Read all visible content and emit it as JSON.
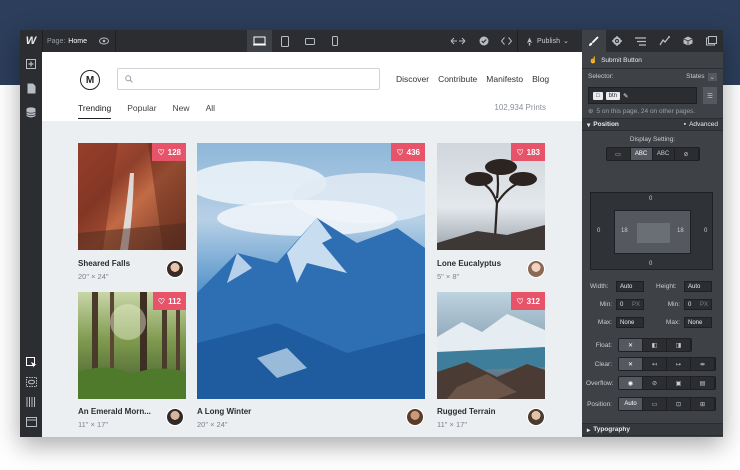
{
  "topbar": {
    "logo": "W",
    "page_label": "Page:",
    "page_value": "Home",
    "publish_label": "Publish"
  },
  "canvas": {
    "logo_letter": "M",
    "nav": [
      "Discover",
      "Contribute",
      "Manifesto",
      "Blog"
    ],
    "tabs": [
      "Trending",
      "Popular",
      "New",
      "All"
    ],
    "prints_count": "102,934 Prints",
    "cards": [
      {
        "title": "Sheared Falls",
        "size": "20\" × 24\"",
        "likes": "128"
      },
      {
        "title": "A Long Winter",
        "size": "20\" × 24\"",
        "likes": "436"
      },
      {
        "title": "Lone Eucalyptus",
        "size": "5\" × 8\"",
        "likes": "183"
      },
      {
        "title": "An Emerald Morn...",
        "size": "11\" × 17\"",
        "likes": "112"
      },
      {
        "title": "Rugged Terrain",
        "size": "11\" × 17\"",
        "likes": "312"
      }
    ]
  },
  "panel": {
    "element_label": "Submit Button",
    "selector_label": "Selector:",
    "states_label": "States",
    "chip_1": "□",
    "chip_2": "btn",
    "selector_note": "5 on this page, 24 on other pages.",
    "position_title": "Position",
    "advanced_label": "Advanced",
    "display_setting": "Display Setting:",
    "display_options": [
      "▭",
      "ABC",
      "ABC",
      "⊘"
    ],
    "box_values": {
      "outer_top": "0",
      "outer_left": "0",
      "outer_right": "0",
      "outer_bottom": "0",
      "pad_left": "18",
      "pad_right": "18"
    },
    "width_label": "Width:",
    "width_value": "Auto",
    "height_label": "Height:",
    "height_value": "Auto",
    "min_label": "Min:",
    "min_w": "0",
    "min_h": "0",
    "px": "PX",
    "max_label": "Max:",
    "max_w": "None",
    "max_h": "None",
    "float_label": "Float:",
    "clear_label": "Clear:",
    "overflow_label": "Overflow:",
    "position_label": "Position:",
    "position_value": "Auto",
    "typography_title": "Typography"
  },
  "colors": {
    "like_badge": "#e7546a",
    "panel_bg": "#3e4146",
    "topbar_bg": "#2b2d31",
    "header_bg": "#2c3e5b"
  }
}
